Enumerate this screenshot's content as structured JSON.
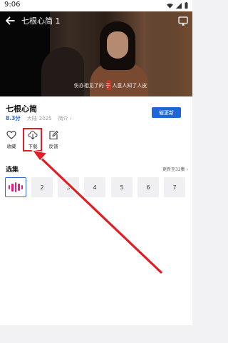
{
  "status_bar": {
    "time": "9:06"
  },
  "player": {
    "title": "七根心简 1",
    "subtitle": "伤亦相见了的 于 人意人知了人皮"
  },
  "info": {
    "title": "七根心简",
    "score": "8.3分",
    "region": "大陆",
    "year": "2025",
    "intro_link": "简介 ›",
    "follow_button": "催更新"
  },
  "actions": [
    {
      "label": "收藏",
      "icon": "heart-icon"
    },
    {
      "label": "下载",
      "icon": "download-cloud-icon"
    },
    {
      "label": "反馈",
      "icon": "feedback-edit-icon"
    }
  ],
  "episodes": {
    "heading": "选集",
    "more": "更新至32集 ›",
    "items": [
      "1",
      "2",
      "3",
      "4",
      "5",
      "6",
      "7"
    ]
  },
  "colors": {
    "accent": "#1d66d8",
    "highlight_red": "#e01e24",
    "playing_bars": "#e2207c"
  }
}
